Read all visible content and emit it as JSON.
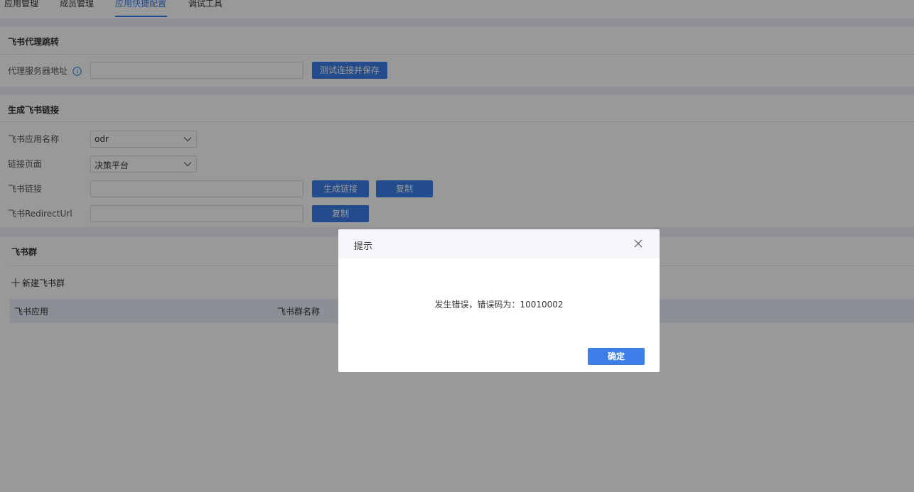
{
  "tabs": [
    "应用管理",
    "成员管理",
    "应用快捷配置",
    "调试工具"
  ],
  "proxy": {
    "title": "飞书代理跳转",
    "server_label": "代理服务器地址",
    "server_value": "",
    "test_button": "测试连接并保存"
  },
  "link": {
    "title": "生成飞书链接",
    "app_name_label": "飞书应用名称",
    "app_name_value": "odr",
    "page_label": "链接页面",
    "page_value": "决策平台",
    "feishu_link_label": "飞书链接",
    "feishu_link_value": "",
    "generate_button": "生成链接",
    "copy_button": "复制",
    "redirect_label": "飞书RedirectUrl",
    "redirect_value": "",
    "redirect_copy_button": "复制"
  },
  "group": {
    "title": "飞书群",
    "new_button": "新建飞书群",
    "columns": [
      "飞书应用",
      "飞书群名称"
    ]
  },
  "dialog": {
    "title": "提示",
    "message": "发生错误，错误码为：10010002",
    "ok_button": "确定"
  },
  "colors": {
    "accent": "#3d7ee8",
    "overlay": "rgba(0,0,0,0.40)"
  }
}
